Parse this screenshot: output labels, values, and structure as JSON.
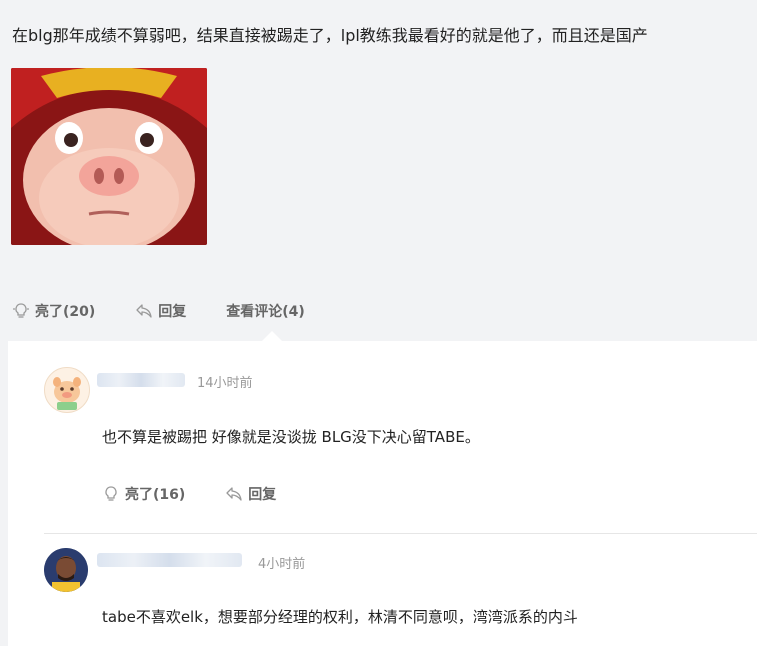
{
  "post": {
    "text": "在blg那年成绩不算弱吧，结果直接被踢走了，lpl教练我最看好的就是他了，而且还是国产",
    "image_icon": "pig-face-meme-image",
    "actions": {
      "like_label": "亮了(20)",
      "reply_label": "回复",
      "view_comments_label": "查看评论(4)"
    }
  },
  "comments": [
    {
      "time": "14小时前",
      "text": "也不算是被踢把 好像就是没谈拢 BLG没下决心留TABE。",
      "like_label": "亮了(16)",
      "reply_label": "回复",
      "avatar_icon": "cartoon-pig-avatar"
    },
    {
      "time": "4小时前",
      "text": "tabe不喜欢elk，想要部分经理的权利，林清不同意呗，湾湾派系的内斗",
      "avatar_icon": "basketball-player-avatar"
    }
  ],
  "colors": {
    "background": "#f2f3f5",
    "panel": "#ffffff",
    "text": "#222222",
    "muted": "#999999",
    "action": "#666666"
  }
}
